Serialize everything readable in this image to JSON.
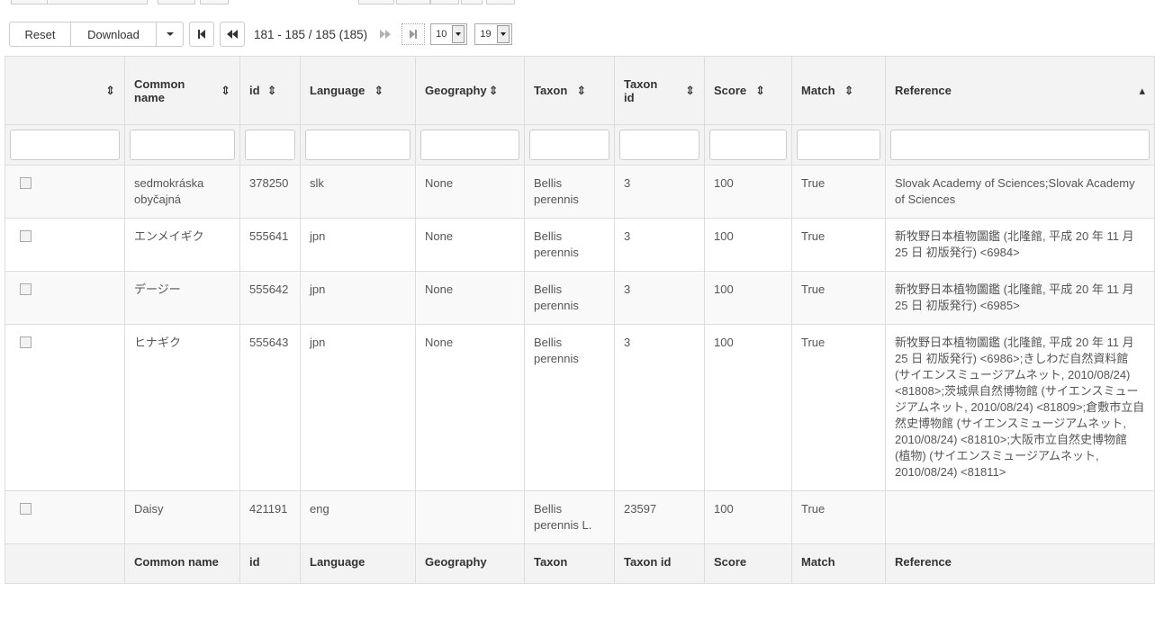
{
  "toolbar": {
    "reset_label": "Reset",
    "download_label": "Download",
    "page_info": "181 - 185 / 185 (185)",
    "page_size": "10",
    "page_number": "19"
  },
  "table": {
    "headers": [
      "",
      "Common name",
      "id",
      "Language",
      "Geography",
      "Taxon",
      "Taxon id",
      "Score",
      "Match",
      "Reference"
    ],
    "rows": [
      {
        "common_name": "sedmokráska obyčajná",
        "id": "378250",
        "language": "slk",
        "geography": "None",
        "taxon": "Bellis perennis",
        "taxon_id": "3",
        "score": "100",
        "match": "True",
        "reference": "Slovak Academy of Sciences;Slovak Academy of Sciences"
      },
      {
        "common_name": "エンメイギク",
        "id": "555641",
        "language": "jpn",
        "geography": "None",
        "taxon": "Bellis perennis",
        "taxon_id": "3",
        "score": "100",
        "match": "True",
        "reference": "新牧野日本植物圖鑑 (北隆館, 平成 20 年 11 月 25 日 初版発行) <6984>"
      },
      {
        "common_name": "デージー",
        "id": "555642",
        "language": "jpn",
        "geography": "None",
        "taxon": "Bellis perennis",
        "taxon_id": "3",
        "score": "100",
        "match": "True",
        "reference": "新牧野日本植物圖鑑 (北隆館, 平成 20 年 11 月 25 日 初版発行) <6985>"
      },
      {
        "common_name": "ヒナギク",
        "id": "555643",
        "language": "jpn",
        "geography": "None",
        "taxon": "Bellis perennis",
        "taxon_id": "3",
        "score": "100",
        "match": "True",
        "reference": "新牧野日本植物圖鑑 (北隆館, 平成 20 年 11 月 25 日 初版発行) <6986>;きしわだ自然資料館 (サイエンスミュージアムネット, 2010/08/24) <81808>;茨城県自然博物館 (サイエンスミュージアムネット, 2010/08/24) <81809>;倉敷市立自然史博物館 (サイエンスミュージアムネット, 2010/08/24) <81810>;大阪市立自然史博物館 (植物) (サイエンスミュージアムネット, 2010/08/24) <81811>"
      },
      {
        "common_name": "Daisy",
        "id": "421191",
        "language": "eng",
        "geography": "",
        "taxon": "Bellis perennis L.",
        "taxon_id": "23597",
        "score": "100",
        "match": "True",
        "reference": ""
      }
    ],
    "footer": [
      "",
      "Common name",
      "id",
      "Language",
      "Geography",
      "Taxon",
      "Taxon id",
      "Score",
      "Match",
      "Reference"
    ]
  }
}
